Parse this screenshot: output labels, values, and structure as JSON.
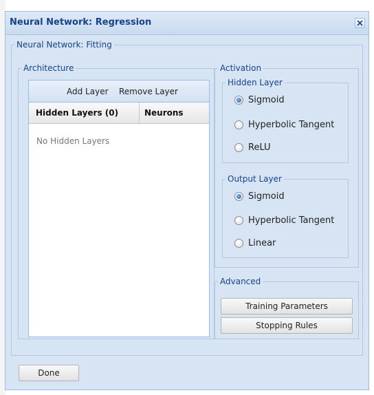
{
  "dialog": {
    "title": "Neural Network: Regression",
    "close_icon": "close-icon"
  },
  "fitting": {
    "legend": "Neural Network: Fitting"
  },
  "architecture": {
    "legend": "Architecture",
    "add_layer_label": "Add Layer",
    "remove_layer_label": "Remove Layer",
    "columns": [
      "Hidden Layers (0)",
      "Neurons"
    ],
    "empty_text": "No Hidden Layers"
  },
  "activation": {
    "legend": "Activation",
    "hidden_layer": {
      "legend": "Hidden Layer",
      "options": [
        "Sigmoid",
        "Hyperbolic Tangent",
        "ReLU"
      ],
      "selected": "Sigmoid"
    },
    "output_layer": {
      "legend": "Output Layer",
      "options": [
        "Sigmoid",
        "Hyperbolic Tangent",
        "Linear"
      ],
      "selected": "Sigmoid"
    }
  },
  "advanced": {
    "legend": "Advanced",
    "training_parameters_label": "Training Parameters",
    "stopping_rules_label": "Stopping Rules"
  },
  "footer": {
    "done_label": "Done"
  },
  "colors": {
    "title_text": "#15428b",
    "panel_bg": "#d7e4f3",
    "border": "#99bbe8"
  }
}
